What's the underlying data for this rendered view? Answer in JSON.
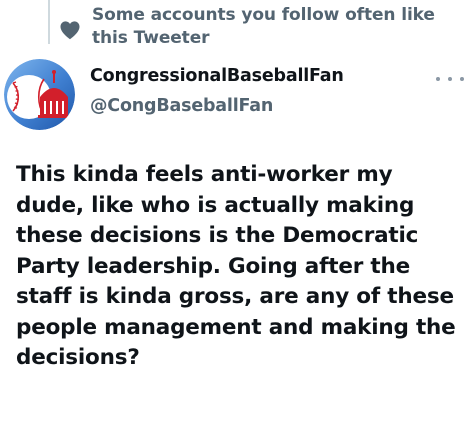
{
  "social_context": {
    "text": "Some accounts you follow often like this Tweeter",
    "icon": "heart-icon"
  },
  "author": {
    "display_name": "CongressionalBaseballFan",
    "handle": "@CongBaseballFan",
    "avatar_icon": "baseball-capitol-logo"
  },
  "menu": {
    "icon": "more-options-icon"
  },
  "tweet": {
    "text": "This kinda feels anti-worker my dude, like who is actually making these decisions is the Democratic Party leadership. Going after the staff is kinda gross, are any of these people management and making the decisions?"
  },
  "colors": {
    "primary_text": "#0f1419",
    "secondary_text": "#536471",
    "avatar_blue": "#3f7fd0",
    "avatar_red": "#d21f2b"
  }
}
